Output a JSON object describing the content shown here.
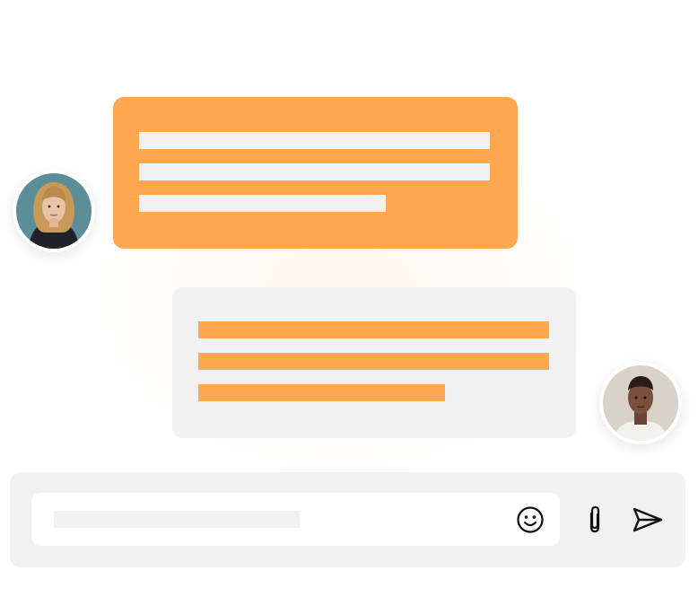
{
  "chat": {
    "incoming_message": {
      "sender_avatar": "woman-with-blonde-hair-avatar",
      "bubble_color": "#FFA852",
      "text_placeholder_color": "#F1F1F1",
      "line_count": 3
    },
    "outgoing_message": {
      "sender_avatar": "man-avatar",
      "bubble_color": "#F1F1F1",
      "text_placeholder_color": "#FFA852",
      "line_count": 3
    }
  },
  "composer": {
    "background_color": "#F1F1F1",
    "input_background_color": "#FFFFFF",
    "icons": [
      "emoji-icon",
      "paperclip-icon",
      "send-icon"
    ]
  }
}
